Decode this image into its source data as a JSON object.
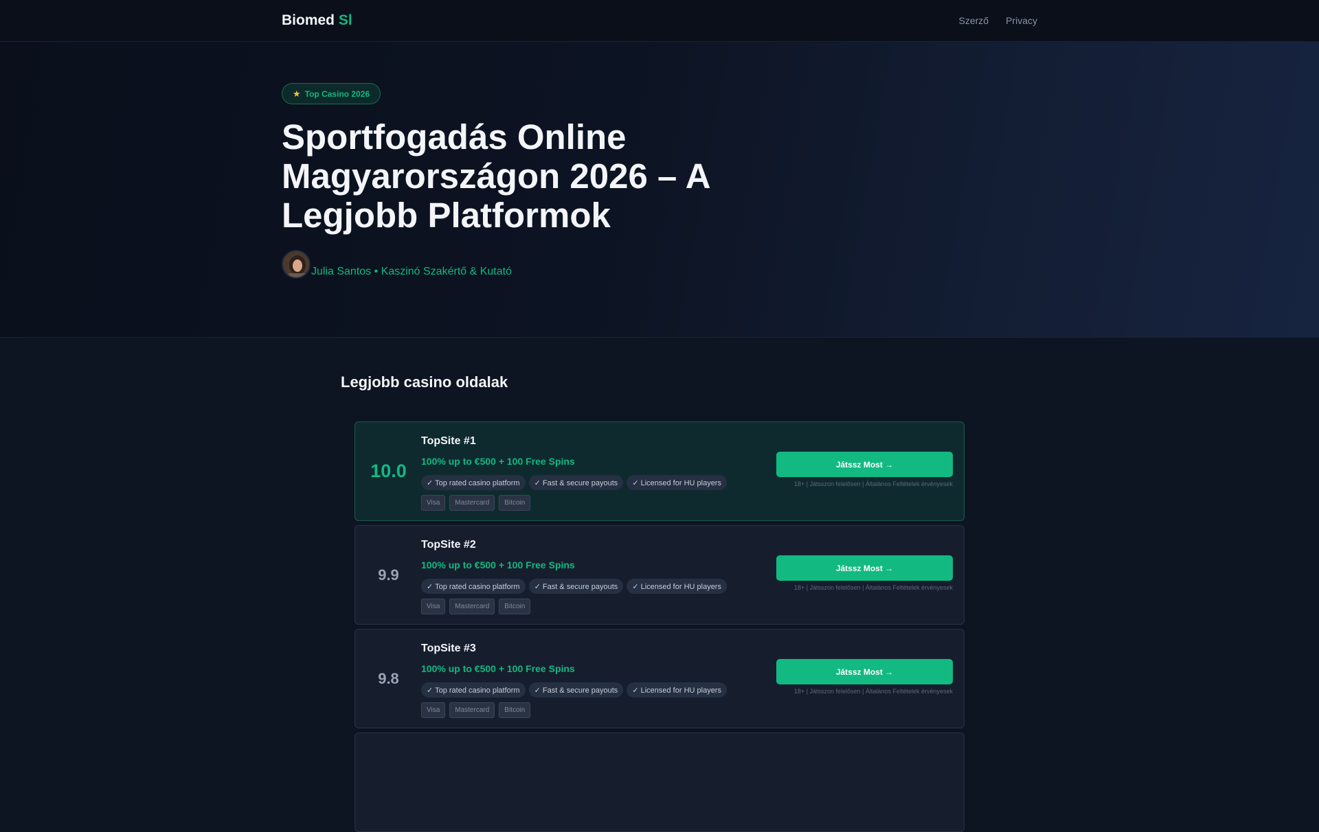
{
  "header": {
    "logo_main": "Biomed",
    "logo_accent": "Sl",
    "nav": [
      {
        "label": "Szerző"
      },
      {
        "label": "Privacy"
      }
    ]
  },
  "hero": {
    "badge": "Top Casino 2026",
    "badge_icon": "star-icon",
    "title": "Sportfogadás Online Magyarországon 2026 – A Legjobb Platformok",
    "author": "Julia Santos • Kaszinó Szakértő & Kutató"
  },
  "list": {
    "title": "Legjobb casino oldalak",
    "cards": [
      {
        "score": "10.0",
        "name": "TopSite #1",
        "bonus": "100% up to €500 + 100 Free Spins",
        "features": [
          "✓ Top rated casino platform",
          "✓ Fast & secure payouts",
          "✓ Licensed for HU players"
        ],
        "payments": [
          "Visa",
          "Mastercard",
          "Bitcoin"
        ],
        "cta": "Játssz Most →",
        "disclaimer": "18+ | Játsszon felelősen | Általános Feltételek érvényesek"
      },
      {
        "score": "9.9",
        "name": "TopSite #2",
        "bonus": "100% up to €500 + 100 Free Spins",
        "features": [
          "✓ Top rated casino platform",
          "✓ Fast & secure payouts",
          "✓ Licensed for HU players"
        ],
        "payments": [
          "Visa",
          "Mastercard",
          "Bitcoin"
        ],
        "cta": "Játssz Most →",
        "disclaimer": "18+ | Játsszon felelősen | Általános Feltételek érvényesek"
      },
      {
        "score": "9.8",
        "name": "TopSite #3",
        "bonus": "100% up to €500 + 100 Free Spins",
        "features": [
          "✓ Top rated casino platform",
          "✓ Fast & secure payouts",
          "✓ Licensed for HU players"
        ],
        "payments": [
          "Visa",
          "Mastercard",
          "Bitcoin"
        ],
        "cta": "Játssz Most →",
        "disclaimer": "18+ | Játsszon felelősen | Általános Feltételek érvényesek"
      }
    ]
  },
  "colors": {
    "accent": "#12b981",
    "background": "#0d1422",
    "card": "#161e2e",
    "featured_card": "#0f2a2f"
  }
}
